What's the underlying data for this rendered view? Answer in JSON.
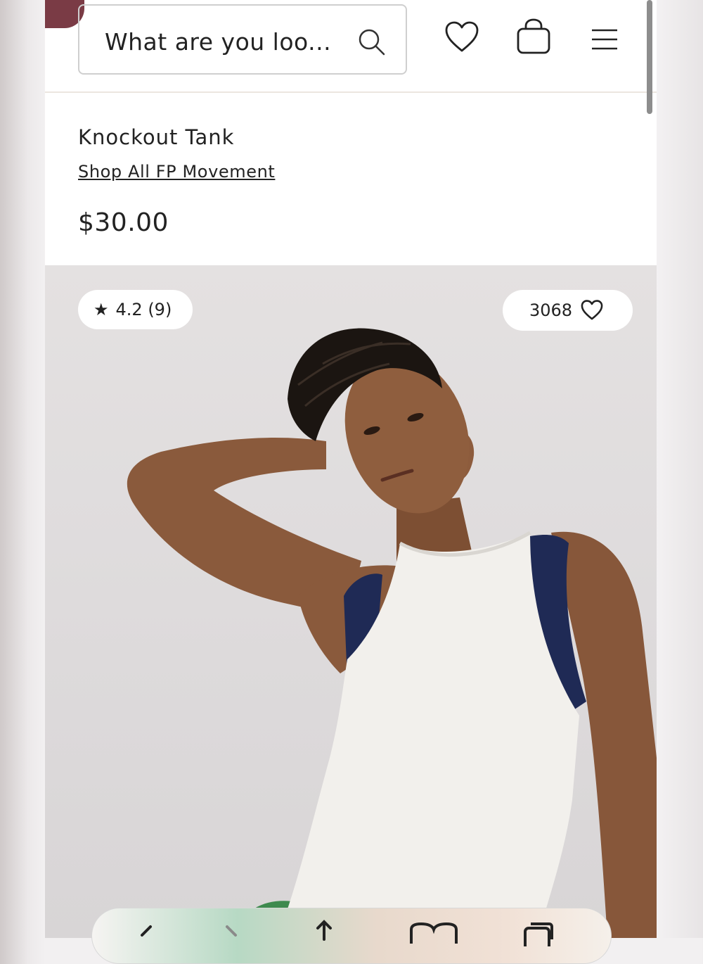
{
  "header": {
    "search_placeholder": "What are you loo...",
    "icons": [
      "search-icon",
      "heart-icon",
      "shopping-bag-icon",
      "menu-icon"
    ]
  },
  "product": {
    "title": "Knockout Tank",
    "collection_link": "Shop All FP Movement",
    "price": "$30.00"
  },
  "image_badges": {
    "rating_star": "★",
    "rating": "4.2 (9)",
    "likes": "3068"
  },
  "browser_nav": {
    "icons": [
      "back-icon",
      "forward-icon",
      "share-icon",
      "bookmarks-icon",
      "tabs-icon"
    ]
  },
  "colors": {
    "brand_accent": "#7a3b45",
    "tank_trim": "#1f2a55"
  }
}
